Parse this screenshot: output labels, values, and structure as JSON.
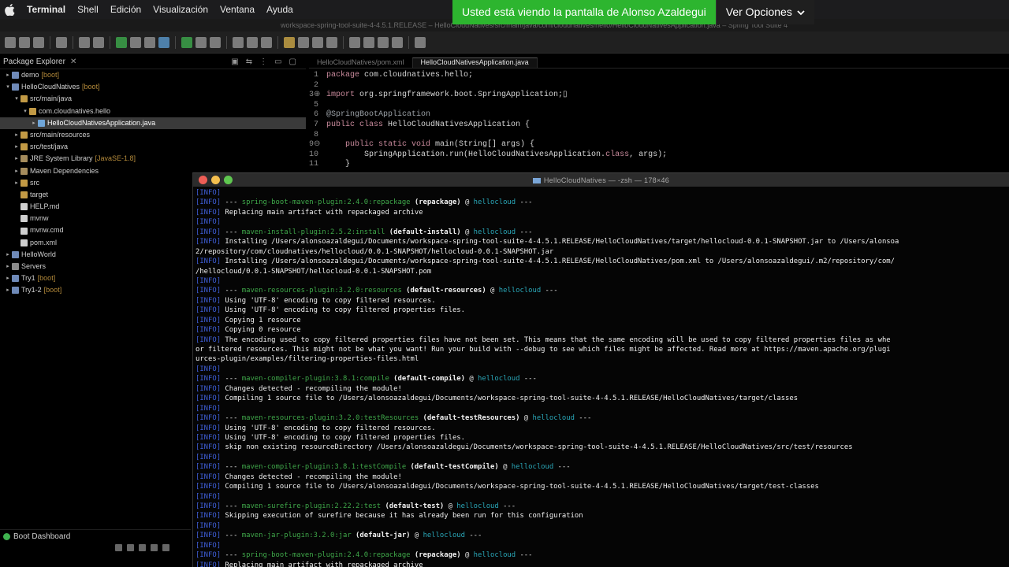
{
  "menubar": {
    "app": "Terminal",
    "items": [
      "Shell",
      "Edición",
      "Visualización",
      "Ventana",
      "Ayuda"
    ]
  },
  "share_banner": {
    "message": "Usted está viendo la pantalla de Alonso Azaldegui",
    "options": "Ver Opciones",
    "color": "#2db52f"
  },
  "ide_title": "workspace-spring-tool-suite-4-4.5.1.RELEASE – HelloCloudNatives/src/main/java/com/cloudnatives/hello/HelloCloudNativesApplication.java – Spring Tool Suite 4",
  "package_explorer": {
    "title": "Package Explorer",
    "items": [
      {
        "indent": 0,
        "arrow": "▸",
        "icon": "proj",
        "label": "demo",
        "decor": "[boot]"
      },
      {
        "indent": 0,
        "arrow": "▾",
        "icon": "proj",
        "label": "HelloCloudNatives",
        "decor": "[boot]"
      },
      {
        "indent": 1,
        "arrow": "▾",
        "icon": "pkgi",
        "label": "src/main/java",
        "decor": ""
      },
      {
        "indent": 2,
        "arrow": "▾",
        "icon": "pkgi",
        "label": "com.cloudnatives.hello",
        "decor": ""
      },
      {
        "indent": 3,
        "arrow": "▸",
        "icon": "java",
        "label": "HelloCloudNativesApplication.java",
        "decor": "",
        "selected": true
      },
      {
        "indent": 1,
        "arrow": "▸",
        "icon": "pkgi",
        "label": "src/main/resources",
        "decor": ""
      },
      {
        "indent": 1,
        "arrow": "▸",
        "icon": "pkgi",
        "label": "src/test/java",
        "decor": ""
      },
      {
        "indent": 1,
        "arrow": "▸",
        "icon": "lib",
        "label": "JRE System Library",
        "decor": "[JavaSE-1.8]"
      },
      {
        "indent": 1,
        "arrow": "▸",
        "icon": "lib",
        "label": "Maven Dependencies",
        "decor": ""
      },
      {
        "indent": 1,
        "arrow": "▸",
        "icon": "pkgi",
        "label": "src",
        "decor": ""
      },
      {
        "indent": 1,
        "arrow": "",
        "icon": "pkgi",
        "label": "target",
        "decor": ""
      },
      {
        "indent": 1,
        "arrow": "",
        "icon": "file",
        "label": "HELP.md",
        "decor": ""
      },
      {
        "indent": 1,
        "arrow": "",
        "icon": "file",
        "label": "mvnw",
        "decor": ""
      },
      {
        "indent": 1,
        "arrow": "",
        "icon": "file",
        "label": "mvnw.cmd",
        "decor": ""
      },
      {
        "indent": 1,
        "arrow": "",
        "icon": "file",
        "label": "pom.xml",
        "decor": ""
      },
      {
        "indent": 0,
        "arrow": "▸",
        "icon": "proj",
        "label": "HelloWorld",
        "decor": ""
      },
      {
        "indent": 0,
        "arrow": "▸",
        "icon": "srv",
        "label": "Servers",
        "decor": ""
      },
      {
        "indent": 0,
        "arrow": "▸",
        "icon": "proj",
        "label": "Try1",
        "decor": "[boot]"
      },
      {
        "indent": 0,
        "arrow": "▸",
        "icon": "proj",
        "label": "Try1-2",
        "decor": "[boot]"
      }
    ]
  },
  "boot_dashboard": {
    "title": "Boot Dashboard"
  },
  "editor": {
    "tabs": [
      {
        "label": "HelloCloudNatives/pom.xml",
        "active": false
      },
      {
        "label": "HelloCloudNativesApplication.java",
        "active": true
      }
    ],
    "lines": [
      {
        "n": "1",
        "parts": [
          {
            "c": "kw",
            "t": "package "
          },
          {
            "c": "",
            "t": "com.cloudnatives.hello;"
          }
        ]
      },
      {
        "n": "2",
        "parts": [
          {
            "c": "",
            "t": ""
          }
        ]
      },
      {
        "n": "3⊕",
        "parts": [
          {
            "c": "kw",
            "t": "import "
          },
          {
            "c": "",
            "t": "org.springframework.boot.SpringApplication;▯"
          }
        ]
      },
      {
        "n": "5",
        "parts": [
          {
            "c": "",
            "t": ""
          }
        ]
      },
      {
        "n": "6",
        "parts": [
          {
            "c": "an",
            "t": "@SpringBootApplication"
          }
        ]
      },
      {
        "n": "7",
        "parts": [
          {
            "c": "kw",
            "t": "public class "
          },
          {
            "c": "",
            "t": "HelloCloudNativesApplication {"
          }
        ]
      },
      {
        "n": "8",
        "parts": [
          {
            "c": "",
            "t": ""
          }
        ]
      },
      {
        "n": "9⊖",
        "parts": [
          {
            "c": "kw",
            "t": "    public static void "
          },
          {
            "c": "",
            "t": "main(String[] args) {"
          }
        ]
      },
      {
        "n": "10",
        "parts": [
          {
            "c": "",
            "t": "        SpringApplication.run(HelloCloudNativesApplication."
          },
          {
            "c": "kw",
            "t": "class"
          },
          {
            "c": "",
            "t": ", args);"
          }
        ]
      },
      {
        "n": "11",
        "parts": [
          {
            "c": "",
            "t": "    }"
          }
        ]
      }
    ]
  },
  "terminal": {
    "title": "HelloCloudNatives — -zsh — 178×46",
    "lines": [
      [
        {
          "c": "info",
          "t": "[INFO]"
        }
      ],
      [
        {
          "c": "info",
          "t": "[INFO]"
        },
        {
          "c": "",
          "t": " --- "
        },
        {
          "c": "plug",
          "t": "spring-boot-maven-plugin:2.4.0:repackage"
        },
        {
          "c": "exe",
          "t": " (repackage)"
        },
        {
          "c": "",
          "t": " @ "
        },
        {
          "c": "proj",
          "t": "hellocloud"
        },
        {
          "c": "",
          "t": " ---"
        }
      ],
      [
        {
          "c": "info",
          "t": "[INFO]"
        },
        {
          "c": "msgb",
          "t": " Replacing main artifact with repackaged archive"
        }
      ],
      [
        {
          "c": "info",
          "t": "[INFO]"
        }
      ],
      [
        {
          "c": "info",
          "t": "[INFO]"
        },
        {
          "c": "",
          "t": " --- "
        },
        {
          "c": "plug",
          "t": "maven-install-plugin:2.5.2:install"
        },
        {
          "c": "exe",
          "t": " (default-install)"
        },
        {
          "c": "",
          "t": " @ "
        },
        {
          "c": "proj",
          "t": "hellocloud"
        },
        {
          "c": "",
          "t": " ---"
        }
      ],
      [
        {
          "c": "info",
          "t": "[INFO]"
        },
        {
          "c": "msgb",
          "t": " Installing /Users/alonsoazaldegui/Documents/workspace-spring-tool-suite-4-4.5.1.RELEASE/HelloCloudNatives/target/hellocloud-0.0.1-SNAPSHOT.jar to /Users/alonsoa"
        }
      ],
      [
        {
          "c": "msgb",
          "t": "2/repository/com/cloudnatives/hellocloud/0.0.1-SNAPSHOT/hellocloud-0.0.1-SNAPSHOT.jar"
        }
      ],
      [
        {
          "c": "info",
          "t": "[INFO]"
        },
        {
          "c": "msgb",
          "t": " Installing /Users/alonsoazaldegui/Documents/workspace-spring-tool-suite-4-4.5.1.RELEASE/HelloCloudNatives/pom.xml to /Users/alonsoazaldegui/.m2/repository/com/"
        }
      ],
      [
        {
          "c": "msgb",
          "t": "/hellocloud/0.0.1-SNAPSHOT/hellocloud-0.0.1-SNAPSHOT.pom"
        }
      ],
      [
        {
          "c": "info",
          "t": "[INFO]"
        }
      ],
      [
        {
          "c": "info",
          "t": "[INFO]"
        },
        {
          "c": "",
          "t": " --- "
        },
        {
          "c": "plug",
          "t": "maven-resources-plugin:3.2.0:resources"
        },
        {
          "c": "exe",
          "t": " (default-resources)"
        },
        {
          "c": "",
          "t": " @ "
        },
        {
          "c": "proj",
          "t": "hellocloud"
        },
        {
          "c": "",
          "t": " ---"
        }
      ],
      [
        {
          "c": "info",
          "t": "[INFO]"
        },
        {
          "c": "msgb",
          "t": " Using 'UTF-8' encoding to copy filtered resources."
        }
      ],
      [
        {
          "c": "info",
          "t": "[INFO]"
        },
        {
          "c": "msgb",
          "t": " Using 'UTF-8' encoding to copy filtered properties files."
        }
      ],
      [
        {
          "c": "info",
          "t": "[INFO]"
        },
        {
          "c": "msgb",
          "t": " Copying 1 resource"
        }
      ],
      [
        {
          "c": "info",
          "t": "[INFO]"
        },
        {
          "c": "msgb",
          "t": " Copying 0 resource"
        }
      ],
      [
        {
          "c": "info",
          "t": "[INFO]"
        },
        {
          "c": "msgb",
          "t": " The encoding used to copy filtered properties files have not been set. This means that the same encoding will be used to copy filtered properties files as whe"
        }
      ],
      [
        {
          "c": "msgb",
          "t": "or filtered resources. This might not be what you want! Run your build with --debug to see which files might be affected. Read more at https://maven.apache.org/plugi"
        }
      ],
      [
        {
          "c": "msgb",
          "t": "urces-plugin/examples/filtering-properties-files.html"
        }
      ],
      [
        {
          "c": "info",
          "t": "[INFO]"
        }
      ],
      [
        {
          "c": "info",
          "t": "[INFO]"
        },
        {
          "c": "",
          "t": " --- "
        },
        {
          "c": "plug",
          "t": "maven-compiler-plugin:3.8.1:compile"
        },
        {
          "c": "exe",
          "t": " (default-compile)"
        },
        {
          "c": "",
          "t": " @ "
        },
        {
          "c": "proj",
          "t": "hellocloud"
        },
        {
          "c": "",
          "t": " ---"
        }
      ],
      [
        {
          "c": "info",
          "t": "[INFO]"
        },
        {
          "c": "msgb",
          "t": " Changes detected - recompiling the module!"
        }
      ],
      [
        {
          "c": "info",
          "t": "[INFO]"
        },
        {
          "c": "msgb",
          "t": " Compiling 1 source file to /Users/alonsoazaldegui/Documents/workspace-spring-tool-suite-4-4.5.1.RELEASE/HelloCloudNatives/target/classes"
        }
      ],
      [
        {
          "c": "info",
          "t": "[INFO]"
        }
      ],
      [
        {
          "c": "info",
          "t": "[INFO]"
        },
        {
          "c": "",
          "t": " --- "
        },
        {
          "c": "plug",
          "t": "maven-resources-plugin:3.2.0:testResources"
        },
        {
          "c": "exe",
          "t": " (default-testResources)"
        },
        {
          "c": "",
          "t": " @ "
        },
        {
          "c": "proj",
          "t": "hellocloud"
        },
        {
          "c": "",
          "t": " ---"
        }
      ],
      [
        {
          "c": "info",
          "t": "[INFO]"
        },
        {
          "c": "msgb",
          "t": " Using 'UTF-8' encoding to copy filtered resources."
        }
      ],
      [
        {
          "c": "info",
          "t": "[INFO]"
        },
        {
          "c": "msgb",
          "t": " Using 'UTF-8' encoding to copy filtered properties files."
        }
      ],
      [
        {
          "c": "info",
          "t": "[INFO]"
        },
        {
          "c": "msgb",
          "t": " skip non existing resourceDirectory /Users/alonsoazaldegui/Documents/workspace-spring-tool-suite-4-4.5.1.RELEASE/HelloCloudNatives/src/test/resources"
        }
      ],
      [
        {
          "c": "info",
          "t": "[INFO]"
        }
      ],
      [
        {
          "c": "info",
          "t": "[INFO]"
        },
        {
          "c": "",
          "t": " --- "
        },
        {
          "c": "plug",
          "t": "maven-compiler-plugin:3.8.1:testCompile"
        },
        {
          "c": "exe",
          "t": " (default-testCompile)"
        },
        {
          "c": "",
          "t": " @ "
        },
        {
          "c": "proj",
          "t": "hellocloud"
        },
        {
          "c": "",
          "t": " ---"
        }
      ],
      [
        {
          "c": "info",
          "t": "[INFO]"
        },
        {
          "c": "msgb",
          "t": " Changes detected - recompiling the module!"
        }
      ],
      [
        {
          "c": "info",
          "t": "[INFO]"
        },
        {
          "c": "msgb",
          "t": " Compiling 1 source file to /Users/alonsoazaldegui/Documents/workspace-spring-tool-suite-4-4.5.1.RELEASE/HelloCloudNatives/target/test-classes"
        }
      ],
      [
        {
          "c": "info",
          "t": "[INFO]"
        }
      ],
      [
        {
          "c": "info",
          "t": "[INFO]"
        },
        {
          "c": "",
          "t": " --- "
        },
        {
          "c": "plug",
          "t": "maven-surefire-plugin:2.22.2:test"
        },
        {
          "c": "exe",
          "t": " (default-test)"
        },
        {
          "c": "",
          "t": " @ "
        },
        {
          "c": "proj",
          "t": "hellocloud"
        },
        {
          "c": "",
          "t": " ---"
        }
      ],
      [
        {
          "c": "info",
          "t": "[INFO]"
        },
        {
          "c": "msgb",
          "t": " Skipping execution of surefire because it has already been run for this configuration"
        }
      ],
      [
        {
          "c": "info",
          "t": "[INFO]"
        }
      ],
      [
        {
          "c": "info",
          "t": "[INFO]"
        },
        {
          "c": "",
          "t": " --- "
        },
        {
          "c": "plug",
          "t": "maven-jar-plugin:3.2.0:jar"
        },
        {
          "c": "exe",
          "t": " (default-jar)"
        },
        {
          "c": "",
          "t": " @ "
        },
        {
          "c": "proj",
          "t": "hellocloud"
        },
        {
          "c": "",
          "t": " ---"
        }
      ],
      [
        {
          "c": "info",
          "t": "[INFO]"
        }
      ],
      [
        {
          "c": "info",
          "t": "[INFO]"
        },
        {
          "c": "",
          "t": " --- "
        },
        {
          "c": "plug",
          "t": "spring-boot-maven-plugin:2.4.0:repackage"
        },
        {
          "c": "exe",
          "t": " (repackage)"
        },
        {
          "c": "",
          "t": " @ "
        },
        {
          "c": "proj",
          "t": "hellocloud"
        },
        {
          "c": "",
          "t": " ---"
        }
      ],
      [
        {
          "c": "info",
          "t": "[INFO]"
        },
        {
          "c": "msgb",
          "t": " Replacing main artifact with repackaged archive"
        }
      ]
    ]
  }
}
